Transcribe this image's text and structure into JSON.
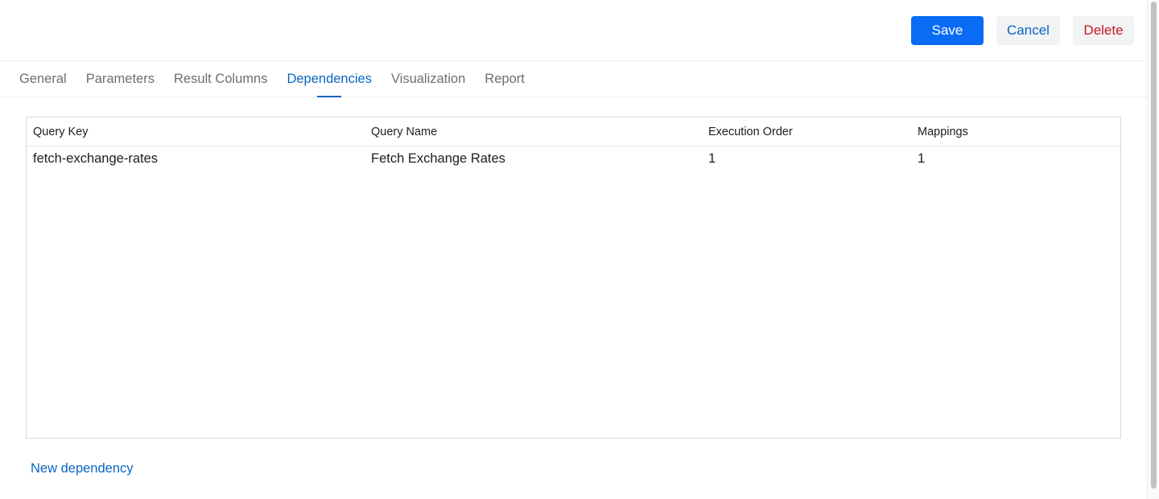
{
  "toolbar": {
    "save_label": "Save",
    "cancel_label": "Cancel",
    "delete_label": "Delete"
  },
  "tabs": [
    {
      "label": "General",
      "active": false
    },
    {
      "label": "Parameters",
      "active": false
    },
    {
      "label": "Result Columns",
      "active": false
    },
    {
      "label": "Dependencies",
      "active": true
    },
    {
      "label": "Visualization",
      "active": false
    },
    {
      "label": "Report",
      "active": false
    }
  ],
  "table": {
    "columns": [
      "Query Key",
      "Query Name",
      "Execution Order",
      "Mappings"
    ],
    "rows": [
      [
        "fetch-exchange-rates",
        "Fetch Exchange Rates",
        "1",
        "1"
      ]
    ]
  },
  "actions": {
    "new_dependency_label": "New dependency"
  },
  "colors": {
    "primary": "#0a6cf5",
    "link": "#0a66c2",
    "danger": "#c8191e",
    "secondary_bg": "#f2f3f5"
  }
}
